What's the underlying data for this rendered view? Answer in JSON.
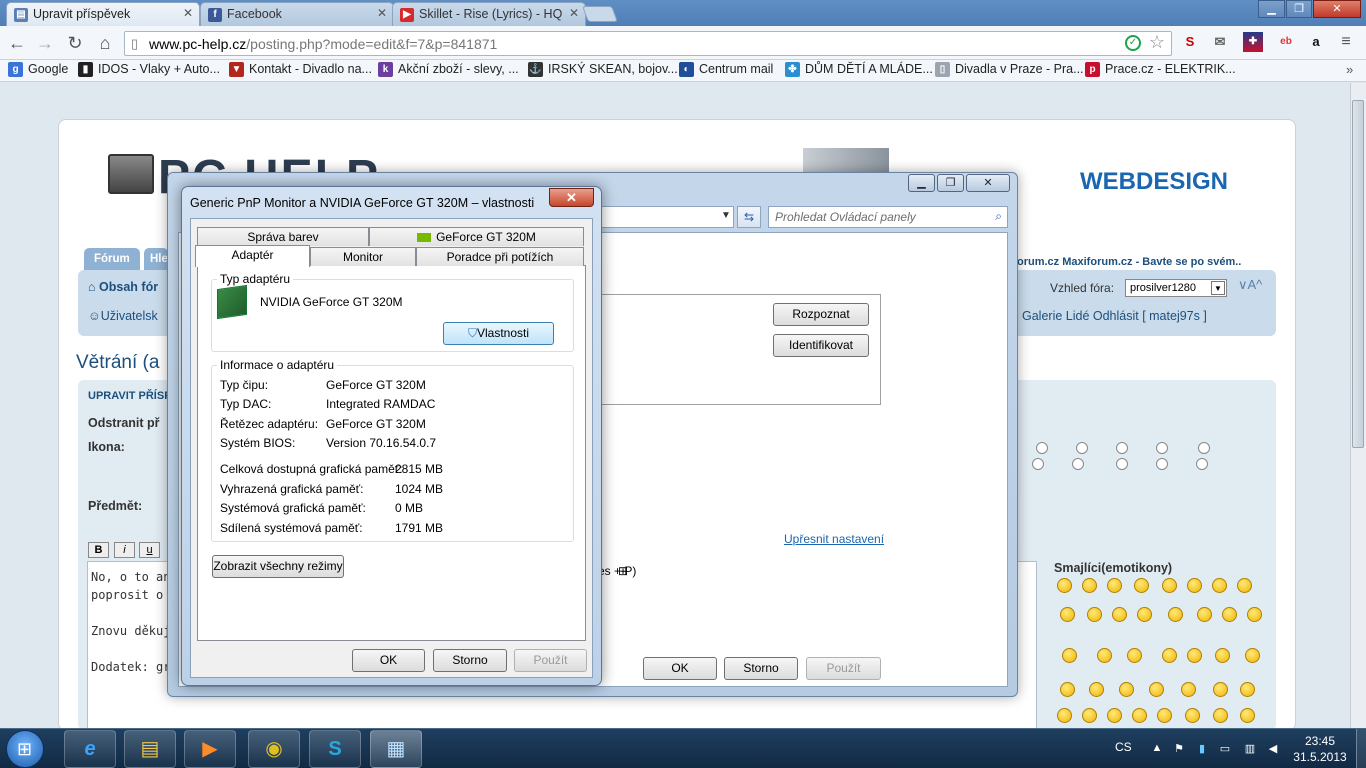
{
  "browser": {
    "tabs": [
      {
        "label": "Upravit příspěvek",
        "icon": "document-icon"
      },
      {
        "label": "Facebook",
        "icon": "facebook-icon"
      },
      {
        "label": "Skillet - Rise (Lyrics) - HQ",
        "icon": "youtube-icon"
      }
    ],
    "url_host": "www.pc-help.cz",
    "url_path": "/posting.php?mode=edit&f=7&p=841871",
    "bookmarks": [
      {
        "label": "Google",
        "color": "#3b73d6",
        "glyph": "g"
      },
      {
        "label": "IDOS - Vlaky + Auto...",
        "color": "#222222",
        "glyph": "▮"
      },
      {
        "label": "Kontakt - Divadlo na...",
        "color": "#b3261e",
        "glyph": "▼"
      },
      {
        "label": "Akční zboží - slevy, ...",
        "color": "#6a3fa0",
        "glyph": "k"
      },
      {
        "label": "IRSKÝ SKEAN, bojov...",
        "color": "#333333",
        "glyph": "⚓"
      },
      {
        "label": "Centrum mail",
        "color": "#1f4f9a",
        "glyph": "◐"
      },
      {
        "label": "DŮM DĚTÍ A MLÁDE...",
        "color": "#2a8fd0",
        "glyph": "✤"
      },
      {
        "label": "Divadla v Praze - Pra...",
        "color": "#9aa5b0",
        "glyph": "▯"
      },
      {
        "label": "Prace.cz - ELEKTRIK...",
        "color": "#c8102e",
        "glyph": "p"
      }
    ]
  },
  "page": {
    "logo": "PC HELP",
    "banner": "WEBDESIGN",
    "forum_tab": "Fórum",
    "forum_tab2": "Hle",
    "breadcrumb": "Obsah fór",
    "members": "Uživatelsk",
    "right_links": "orum.cz  Maxiforum.cz - Bavte se po svém..",
    "theme_label": "Vzhled fóra:",
    "theme_value": "prosilver1280",
    "user_links": "Galerie   Lidé   Odhlásit [ matej97s ]",
    "title": "Větrání (a",
    "panel_title": "UPRAVIT PŘÍSP",
    "remove_label": "Odstranit př",
    "icon_label": "Ikona:",
    "subject_label": "Předmět:",
    "fmt": [
      "B",
      "i",
      "u"
    ],
    "text_lines": [
      "No, o to ani n",
      "poprosit o ně",
      "",
      "Znovu děkuji",
      "",
      "Dodatek: gra"
    ],
    "smileys_title": "Smajlíci(emotikony)"
  },
  "cp": {
    "search_placeholder": "Prohledat Ovládací panely",
    "btn_detect": "Rozpoznat",
    "btn_identify": "Identifikovat",
    "link_advanced": "Upřesnit nastavení",
    "hint": "es  + P)",
    "btn_ok": "OK",
    "btn_cancel": "Storno",
    "btn_apply": "Použít"
  },
  "dialog": {
    "title": "Generic PnP Monitor a NVIDIA GeForce GT 320M – vlastnosti",
    "tabs_top": [
      "Správa barev",
      "GeForce GT 320M"
    ],
    "tabs_bottom": [
      "Adaptér",
      "Monitor",
      "Poradce při potížích"
    ],
    "adapter_group": "Typ adaptéru",
    "adapter_name": "NVIDIA GeForce GT 320M",
    "btn_properties": "Vlastnosti",
    "info_group": "Informace o adaptéru",
    "info": [
      {
        "k": "Typ čipu:",
        "v": "GeForce GT 320M"
      },
      {
        "k": "Typ DAC:",
        "v": "Integrated RAMDAC"
      },
      {
        "k": "Řetězec adaptéru:",
        "v": "GeForce GT 320M"
      },
      {
        "k": "Systém BIOS:",
        "v": "Version 70.16.54.0.7"
      }
    ],
    "memory": [
      {
        "k": "Celková dostupná grafická paměť:",
        "v": "2815 MB"
      },
      {
        "k": "Vyhrazená grafická paměť:",
        "v": "1024 MB"
      },
      {
        "k": "Systémová grafická paměť:",
        "v": "0 MB"
      },
      {
        "k": "Sdílená systémová paměť:",
        "v": "1791 MB"
      }
    ],
    "btn_list_modes": "Zobrazit všechny režimy",
    "btn_ok": "OK",
    "btn_cancel": "Storno",
    "btn_apply": "Použít"
  },
  "taskbar": {
    "language": "CS",
    "time": "23:45",
    "date": "31.5.2013"
  }
}
